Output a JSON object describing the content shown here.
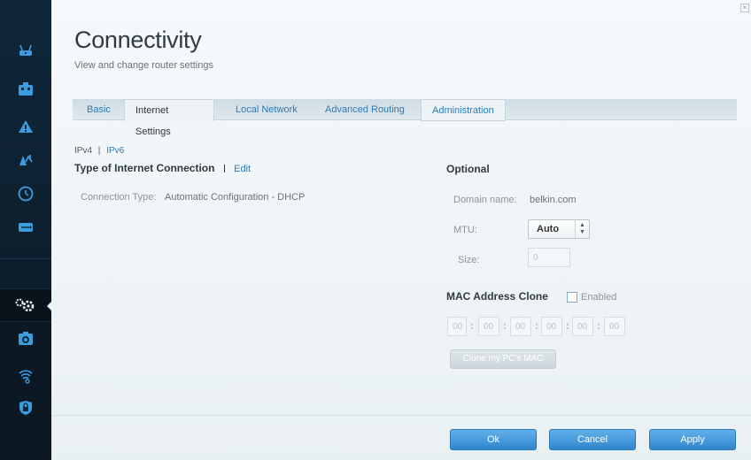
{
  "header": {
    "title": "Connectivity",
    "subtitle": "View and change router settings",
    "close_icon": "×"
  },
  "tabs": [
    {
      "label": "Basic",
      "active": false
    },
    {
      "label": "Internet Settings",
      "active": true
    },
    {
      "label": "Local Network",
      "active": false
    },
    {
      "label": "Advanced Routing",
      "active": false
    },
    {
      "label": "Administration",
      "active": false
    }
  ],
  "ip_version": {
    "ipv4": "IPv4",
    "separator": "|",
    "ipv6": "IPv6"
  },
  "internet_connection": {
    "heading": "Type of Internet Connection",
    "edit_label": "Edit",
    "connection_type_label": "Connection Type:",
    "connection_type_value": "Automatic Configuration - DHCP"
  },
  "optional": {
    "heading": "Optional",
    "domain_label": "Domain name:",
    "domain_value": "belkin.com",
    "mtu_label": "MTU:",
    "mtu_value": "Auto",
    "size_label": "Size:",
    "size_value": "0"
  },
  "mac_clone": {
    "heading": "MAC Address Clone",
    "enabled_label": "Enabled",
    "enabled_checked": false,
    "octets": [
      "00",
      "00",
      "00",
      "00",
      "00",
      "00"
    ],
    "clone_button": "Clone my PC's MAC"
  },
  "footer": {
    "ok": "Ok",
    "cancel": "Cancel",
    "apply": "Apply"
  },
  "sidebar": {
    "items": [
      {
        "icon": "router-icon"
      },
      {
        "icon": "device-list-icon"
      },
      {
        "icon": "troubleshooting-icon"
      },
      {
        "icon": "parental-controls-icon"
      },
      {
        "icon": "clock-icon"
      },
      {
        "icon": "usb-storage-icon"
      },
      {
        "icon": "connectivity-gear-icon",
        "active": true
      },
      {
        "icon": "speed-test-icon"
      },
      {
        "icon": "wireless-icon"
      },
      {
        "icon": "security-shield-icon"
      }
    ]
  },
  "colors": {
    "accent": "#2a7ab8",
    "button_blue": "#3a90d4",
    "sidebar": "#0d1b27"
  }
}
